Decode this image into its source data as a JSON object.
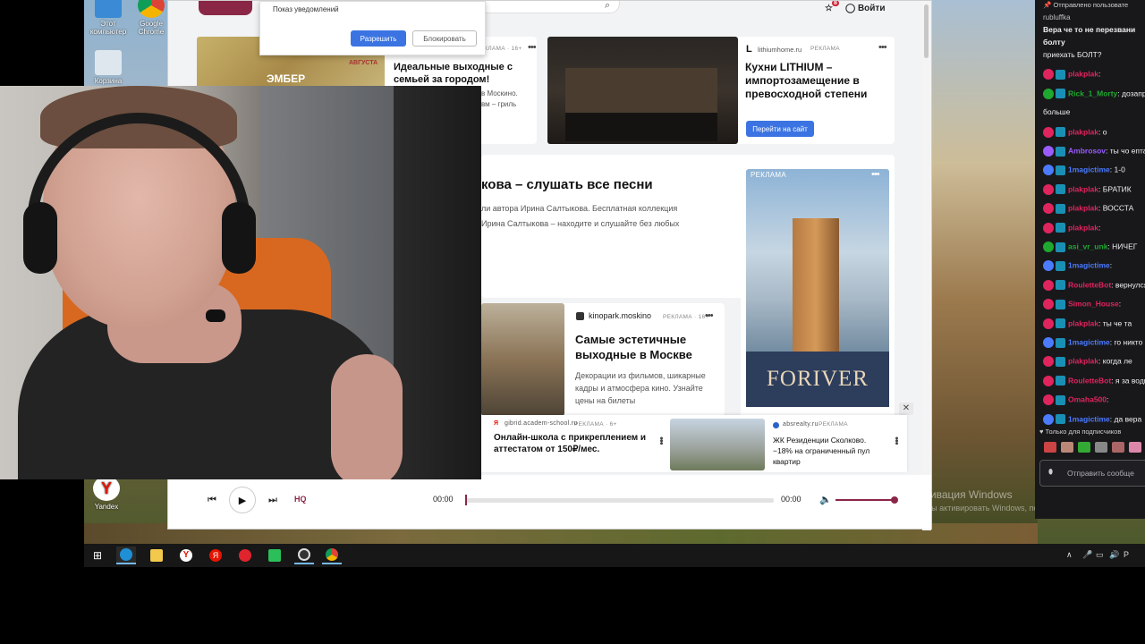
{
  "desktop": {
    "icons": [
      {
        "label": "Этот компьютер"
      },
      {
        "label": "Google Chrome"
      },
      {
        "label": "Корзина"
      },
      {
        "label": "Yandex"
      }
    ]
  },
  "browser": {
    "header": {
      "login_label": "Войти",
      "badge_count": "8"
    },
    "notification": {
      "title": "Показ уведомлений",
      "allow_label": "Разрешить",
      "block_label": "Блокировать"
    },
    "cards": {
      "event": {
        "ad_label": "РЕКЛАМА · 16+",
        "img_title": "ЭМБЕР",
        "img_month": "АВГУСТА",
        "title": "Идеальные выходные с семьей за городом!",
        "line1": "в Москино.",
        "line2": "вм – гриль"
      },
      "kitchen": {
        "domain": "lithiumhome.ru",
        "ad_label": "РЕКЛАМА",
        "title": "Кухни LITHIUM – импортозамещение в превосходной степени",
        "button": "Перейти на сайт"
      },
      "music": {
        "title": "кова – слушать все песни",
        "line1": "ли автора Ирина Салтыкова. Бесплатная коллекция",
        "line2": "Ирина Салтыкова – находите и слушайте без любых"
      },
      "tower": {
        "ad_label": "РЕКЛАМА",
        "brand": "FORIVER"
      },
      "kinopark": {
        "domain": "kinopark.moskino",
        "ad_label": "РЕКЛАМА · 16+",
        "title": "Самые эстетичные выходные в Москве",
        "desc": "Декорации из фильмов, шикарные кадры и атмосфера кино. Узнайте цены на билеты"
      },
      "school": {
        "domain": "gibrid.academ-school.ru",
        "ad_label": "РЕКЛАМА · 6+",
        "title": "Онлайн-школа с прикреплением и аттестатом от 150₽/мес."
      },
      "absrealty": {
        "domain": "absrealty.ru",
        "ad_label": "РЕКЛАМА",
        "title": "ЖК Резиденции Сколково. −18% на ограниченный пул квартир"
      }
    },
    "player": {
      "hq_label": "HQ",
      "time_current": "00:00",
      "time_total": "00:00",
      "progress_pct": 0,
      "volume_pct": 100
    },
    "watermark": {
      "line1": "Активация Windows",
      "line2": "Чтобы активировать Windows, перейдите в раздел \"Пар"
    }
  },
  "chat": {
    "pinned_label": "Отправлено пользовате",
    "pinned_user": "rubluffka",
    "pinned_text": "Вера че то не перезвани",
    "pinned_text2": "болту",
    "messages": [
      {
        "user": "",
        "text": "приехать БОЛТ?",
        "color": "#efeff1"
      },
      {
        "user": "plakplak",
        "text": "",
        "color": "#e0245e"
      },
      {
        "user": "Rick_1_Morty",
        "text": "дозаправк",
        "color": "#1fa830"
      },
      {
        "user": "",
        "text": "больше",
        "color": "#efeff1"
      },
      {
        "user": "plakplak",
        "text": "о",
        "color": "#e0245e"
      },
      {
        "user": "Ambrosov",
        "text": "ты чо епта",
        "color": "#9a5cff"
      },
      {
        "user": "1magictime",
        "text": "1-0",
        "color": "#4b7bff"
      },
      {
        "user": "plakplak",
        "text": "БРАТИК",
        "color": "#e0245e"
      },
      {
        "user": "plakplak",
        "text": "ВОССТА",
        "color": "#e0245e"
      },
      {
        "user": "plakplak",
        "text": "",
        "color": "#e0245e"
      },
      {
        "user": "asi_vr_unk",
        "text": "НИЧЕГ",
        "color": "#1fa830"
      },
      {
        "user": "1magictime",
        "text": "",
        "color": "#4b7bff"
      },
      {
        "user": "RouletteBot",
        "text": "вернулся уф",
        "color": "#e0245e"
      },
      {
        "user": "Simon_House",
        "text": "",
        "color": "#e0245e"
      },
      {
        "user": "plakplak",
        "text": "ты че та",
        "color": "#e0245e"
      },
      {
        "user": "1magictime",
        "text": "го никто",
        "color": "#4b7bff"
      },
      {
        "user": "plakplak",
        "text": "когда ле",
        "color": "#e0245e"
      },
      {
        "user": "RouletteBot",
        "text": "я за водкой",
        "color": "#e0245e"
      },
      {
        "user": "Omaha500",
        "text": "",
        "color": "#e0245e"
      },
      {
        "user": "1magictime",
        "text": "да вера",
        "color": "#4b7bff"
      }
    ],
    "subs_label": "Только для подписчиков",
    "input_placeholder": "Отправить сообще"
  }
}
